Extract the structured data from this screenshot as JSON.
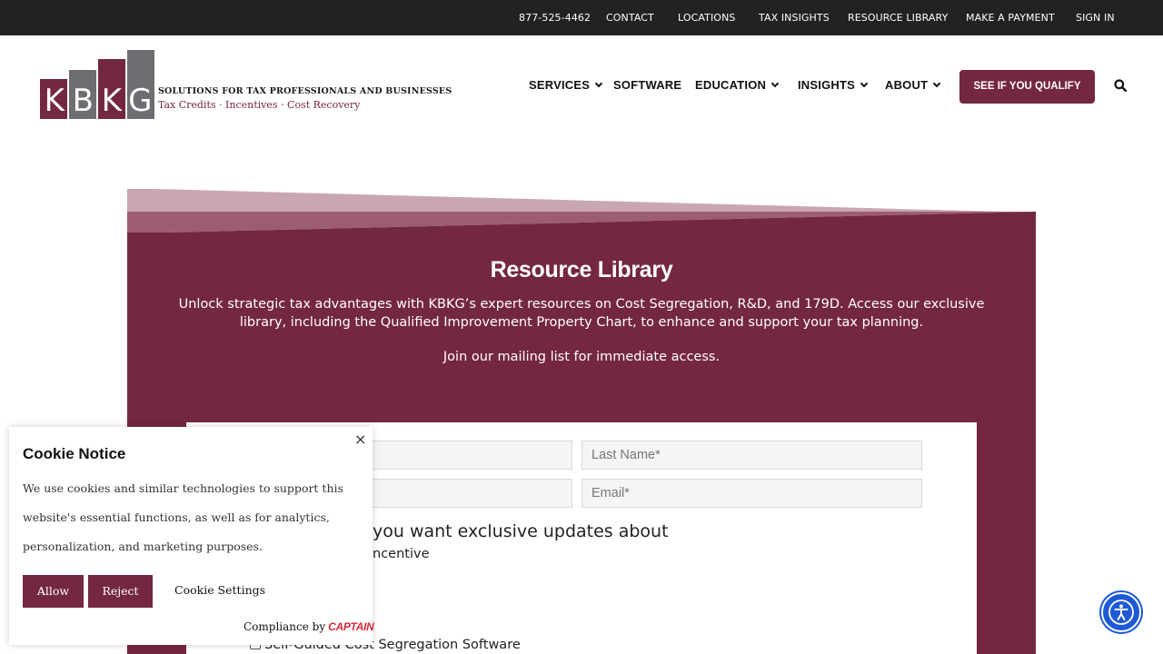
{
  "topbar": {
    "links": [
      "877-525-4462",
      "CONTACT",
      "LOCATIONS",
      "TAX INSIGHTS",
      "RESOURCE LIBRARY",
      "MAKE A PAYMENT",
      "SIGN IN"
    ]
  },
  "logo": {
    "letters": [
      "K",
      "B",
      "K",
      "G"
    ],
    "tagline1": "SOLUTIONS FOR TAX PROFESSIONALS AND BUSINESSES",
    "tagline2": "Tax Credits · Incentives · Cost Recovery"
  },
  "nav": {
    "items": [
      {
        "label": "SERVICES",
        "dropdown": true
      },
      {
        "label": "SOFTWARE",
        "dropdown": false
      },
      {
        "label": "EDUCATION",
        "dropdown": true
      },
      {
        "label": "INSIGHTS",
        "dropdown": true
      },
      {
        "label": "ABOUT",
        "dropdown": true
      }
    ],
    "cta": "SEE IF YOU QUALIFY",
    "search_icon": "search-icon"
  },
  "hero": {
    "title": "Resource Library",
    "text": "Unlock strategic tax advantages with KBKG’s expert resources on Cost Segregation, R&D, and 179D. Access our exclusive library, including the Qualified Improvement Property Chart, to enhance and support your tax planning.",
    "join": "Join our mailing list for immediate access."
  },
  "form": {
    "last_name_placeholder": "Last Name*",
    "email_placeholder": "Email*",
    "question_partial": "you want exclusive updates about",
    "option_partial": "ncentive",
    "option_software": "Self-Guided Cost Segregation Software"
  },
  "cookie": {
    "title": "Cookie Notice",
    "body": "We use cookies and similar technologies to support this website's essential functions, as well as for analytics, personalization, and marketing purposes.",
    "allow": "Allow",
    "reject": "Reject",
    "settings": "Cookie Settings",
    "compliance": "Compliance by",
    "captain": "CAPTAIN",
    "close": "×"
  },
  "colors": {
    "brand": "#742740",
    "topbar": "#222222",
    "accessibility": "#1e5ad6"
  }
}
